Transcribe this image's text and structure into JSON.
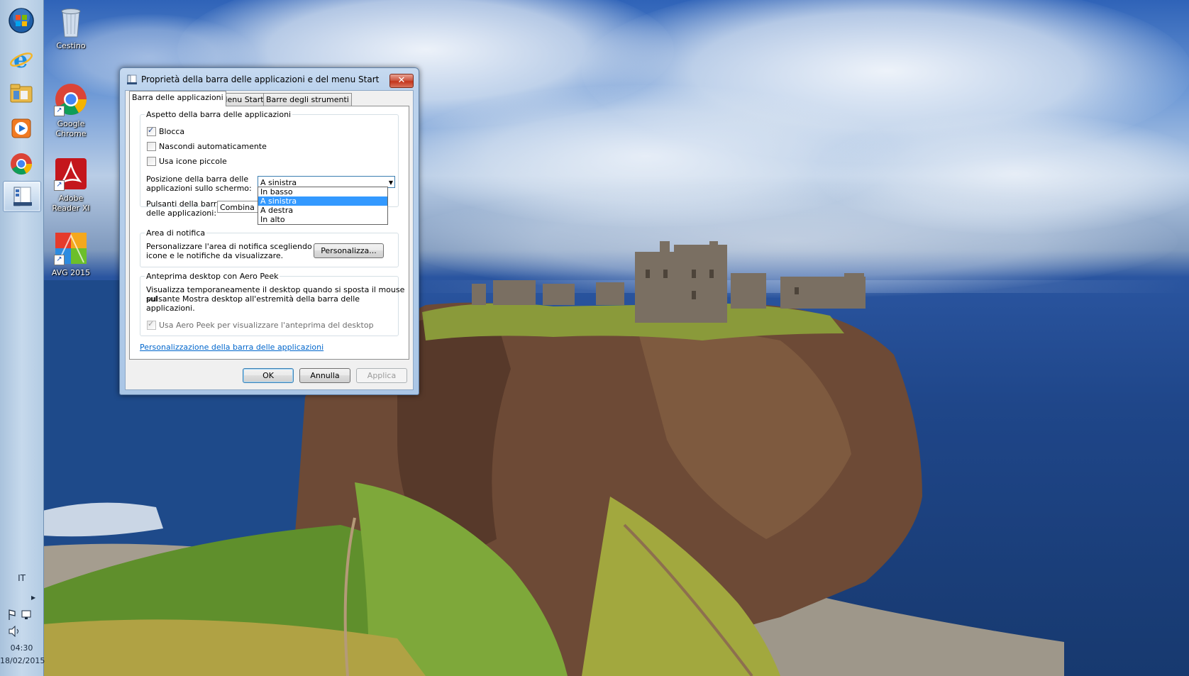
{
  "taskbar": {
    "buttons": [
      {
        "name": "start-button",
        "icon": "windows-orb-icon"
      },
      {
        "name": "internet-explorer",
        "icon": "internet-explorer-icon"
      },
      {
        "name": "file-explorer",
        "icon": "folder-library-icon"
      },
      {
        "name": "media-player",
        "icon": "media-player-icon"
      },
      {
        "name": "google-chrome",
        "icon": "chrome-icon"
      },
      {
        "name": "taskbar-properties",
        "icon": "taskbar-properties-icon",
        "active": true
      }
    ],
    "tray": {
      "language": "IT",
      "time": "04:30",
      "date": "18/02/2015"
    }
  },
  "desktop": {
    "icons": [
      {
        "label1": "Cestino",
        "label2": ""
      },
      {
        "label1": "Google",
        "label2": "Chrome"
      },
      {
        "label1": "Adobe",
        "label2": "Reader XI"
      },
      {
        "label1": "AVG 2015",
        "label2": ""
      }
    ]
  },
  "dialog": {
    "title": "Proprietà della barra delle applicazioni e del menu Start",
    "close_label": "✕",
    "tabs": [
      "Barra delle applicazioni",
      "Menu Start",
      "Barre degli strumenti"
    ],
    "appearance": {
      "legend": "Aspetto della barra delle applicazioni",
      "lock": {
        "label": "Blocca",
        "checked": true
      },
      "autohide": {
        "label": "Nascondi automaticamente",
        "checked": false
      },
      "small_icons": {
        "label": "Usa icone piccole",
        "checked": false
      },
      "position_label_1": "Posizione della barra delle",
      "position_label_2": "applicazioni sullo schermo:",
      "position_value": "A sinistra",
      "position_options": [
        "In basso",
        "A sinistra",
        "A destra",
        "In alto"
      ],
      "buttons_label_1": "Pulsanti della barra",
      "buttons_label_2": "delle applicazioni:",
      "buttons_value": "Combina s"
    },
    "notification": {
      "legend": "Area di notifica",
      "text_1": "Personalizzare l'area di notifica scegliendo le",
      "text_2": "icone e le notifiche da visualizzare.",
      "customize_button": "Personalizza..."
    },
    "aero_peek": {
      "legend": "Anteprima desktop con Aero Peek",
      "text_1": "Visualizza temporaneamente il desktop quando si sposta il mouse sul",
      "text_2": "pulsante Mostra desktop all'estremità della barra delle applicazioni.",
      "checkbox_label": "Usa Aero Peek per visualizzare l'anteprima del desktop",
      "checked": true
    },
    "help_link": "Personalizzazione della barra delle applicazioni",
    "ok": "OK",
    "cancel": "Annulla",
    "apply": "Applica"
  },
  "colors": {
    "taskbar": "#b8cfe6",
    "selection": "#3399ff",
    "link": "#0066cc"
  }
}
